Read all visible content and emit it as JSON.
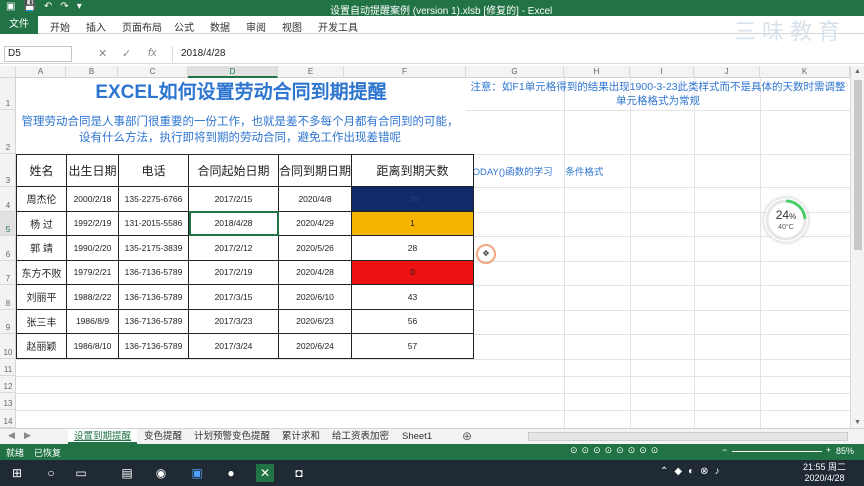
{
  "window": {
    "title": "设置自动提醒案例 (version 1).xlsb [修复的] - Excel",
    "logo": "三味教育"
  },
  "ribbon": {
    "file": "文件",
    "tabs": [
      "开始",
      "插入",
      "页面布局",
      "公式",
      "数据",
      "审阅",
      "视图",
      "开发工具"
    ]
  },
  "formula_bar": {
    "name_box": "D5",
    "value": "2018/4/28",
    "cancel": "✕",
    "enter": "✓",
    "fx": "fx"
  },
  "columns": [
    "A",
    "B",
    "C",
    "D",
    "E",
    "F",
    "G",
    "H",
    "I",
    "J",
    "K"
  ],
  "rows": [
    "1",
    "2",
    "3",
    "4",
    "5",
    "6",
    "7",
    "8",
    "9",
    "10",
    "11",
    "12",
    "13",
    "14"
  ],
  "sheet": {
    "title": "EXCEL如何设置劳动合同到期提醒",
    "description": "管理劳动合同是人事部门很重要的一份工作，也就是差不多每个月都有合同到的可能，设有什么方法，执行即将到期的劳动合同，避免工作出现差错呢",
    "note": "注意：如F1单元格得到的结果出现1900-3-23此类样式而不是具体的天数时需调整单元格格式为常规",
    "link1": "TODAY()函数的学习",
    "link2": "条件格式",
    "headers": [
      "姓名",
      "出生日期",
      "电话",
      "合同起始日期",
      "合同到期日期",
      "距离到期天数"
    ],
    "records": [
      {
        "name": "周杰伦",
        "birth": "2000/2/18",
        "phone": "135-2275-6766",
        "start": "2017/2/15",
        "end": "2020/4/8",
        "days": "-20",
        "fill": "#0f2b68"
      },
      {
        "name": "杨  过",
        "birth": "1992/2/19",
        "phone": "131-2015-5586",
        "start": "2018/4/28",
        "end": "2020/4/29",
        "days": "1",
        "fill": "#f5b400"
      },
      {
        "name": "郭  靖",
        "birth": "1990/2/20",
        "phone": "135-2175-3839",
        "start": "2017/2/12",
        "end": "2020/5/26",
        "days": "28",
        "fill": "#ffffff"
      },
      {
        "name": "东方不败",
        "birth": "1979/2/21",
        "phone": "136-7136-5789",
        "start": "2017/2/19",
        "end": "2020/4/28",
        "days": "0",
        "fill": "#ee1111"
      },
      {
        "name": "刘丽平",
        "birth": "1988/2/22",
        "phone": "136-7136-5789",
        "start": "2017/3/15",
        "end": "2020/6/10",
        "days": "43",
        "fill": "#ffffff"
      },
      {
        "name": "张三丰",
        "birth": "1986/8/9",
        "phone": "136-7136-5789",
        "start": "2017/3/23",
        "end": "2020/6/23",
        "days": "56",
        "fill": "#ffffff"
      },
      {
        "name": "赵丽颖",
        "birth": "1986/8/10",
        "phone": "136-7136-5789",
        "start": "2017/3/24",
        "end": "2020/6/24",
        "days": "57",
        "fill": "#ffffff"
      }
    ]
  },
  "sheet_tabs": [
    "设置到期提醒",
    "变色提醒",
    "计划预警变色提醒",
    "累计求和",
    "给工资表加密",
    "Sheet1"
  ],
  "status": {
    "ready": "就绪",
    "recovered": "已恢复",
    "zoom": "85%"
  },
  "widget": {
    "percent": "24",
    "percent_unit": "%",
    "temp": "40°C"
  },
  "clock": {
    "time": "21:55 周二",
    "date": "2020/4/28"
  }
}
